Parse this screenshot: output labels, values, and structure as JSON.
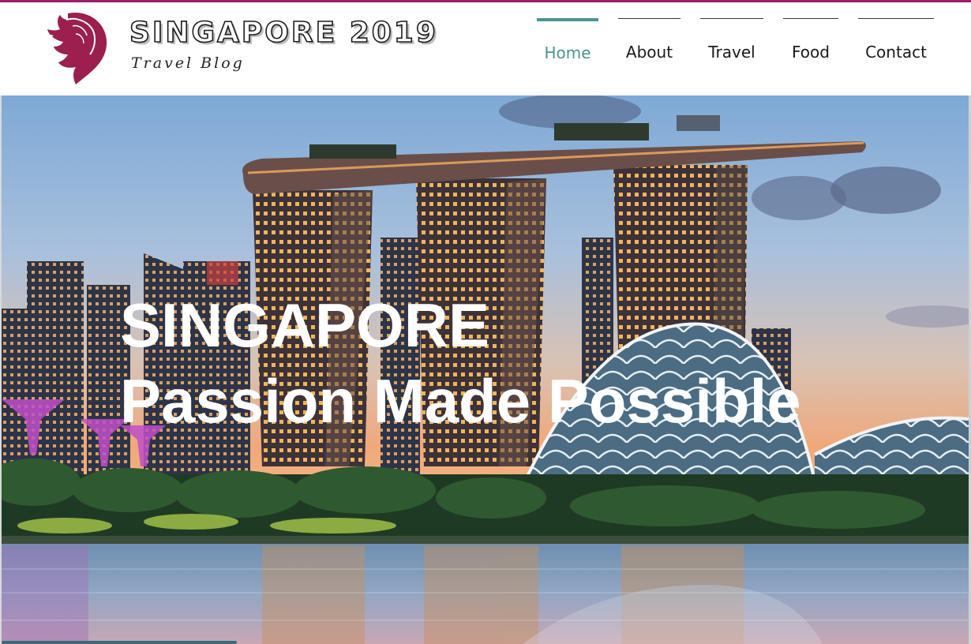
{
  "brand": {
    "title": "SINGAPORE 2019",
    "subtitle": "Travel Blog",
    "logo_icon": "merlion-icon",
    "accent_color": "#9b1f6a"
  },
  "nav": {
    "active_color": "#4a938f",
    "items": [
      {
        "label": "Home",
        "active": true
      },
      {
        "label": "About",
        "active": false
      },
      {
        "label": "Travel",
        "active": false
      },
      {
        "label": "Food",
        "active": false
      },
      {
        "label": "Contact",
        "active": false
      }
    ]
  },
  "hero": {
    "line1": "SINGAPORE",
    "line2": "Passion Made Possible"
  }
}
